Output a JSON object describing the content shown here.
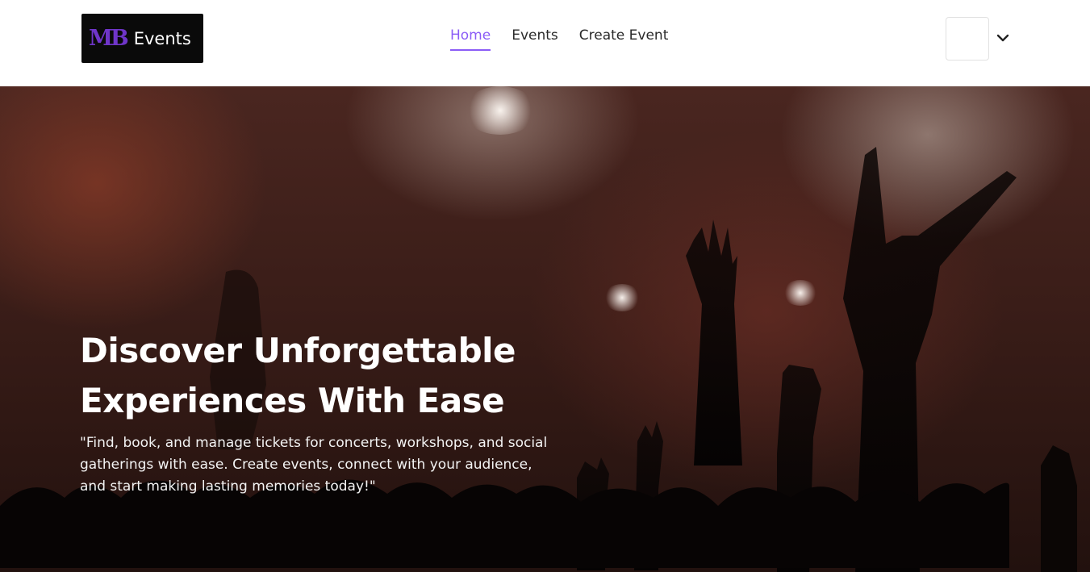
{
  "brand": {
    "logo_mark": "MB",
    "logo_text": "Events"
  },
  "nav": {
    "items": [
      {
        "label": "Home",
        "active": true
      },
      {
        "label": "Events",
        "active": false
      },
      {
        "label": "Create Event",
        "active": false
      }
    ]
  },
  "user_menu": {
    "icon": "chevron-down-icon"
  },
  "hero": {
    "title_line1": "Discover Unforgettable",
    "title_line2": "Experiences With Ease",
    "description": "\"Find, book, and manage tickets for concerts, workshops, and social gatherings with ease. Create events, connect with your audience, and start making lasting memories today!\""
  },
  "colors": {
    "accent": "#8b5cf6",
    "logo_bg": "#0a0a0a",
    "hero_text": "#ffffff"
  }
}
